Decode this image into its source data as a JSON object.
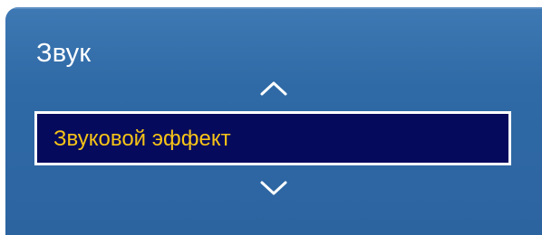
{
  "menu": {
    "title": "Звук",
    "selected_item": {
      "label": "Звуковой эффект"
    },
    "icons": {
      "up": "chevron-up-icon",
      "down": "chevron-down-icon"
    }
  },
  "colors": {
    "panel_background": "#2f6aa6",
    "selection_background": "#050a5c",
    "selection_border": "#ffffff",
    "selection_text": "#f6c317",
    "title_text": "#ffffff"
  }
}
